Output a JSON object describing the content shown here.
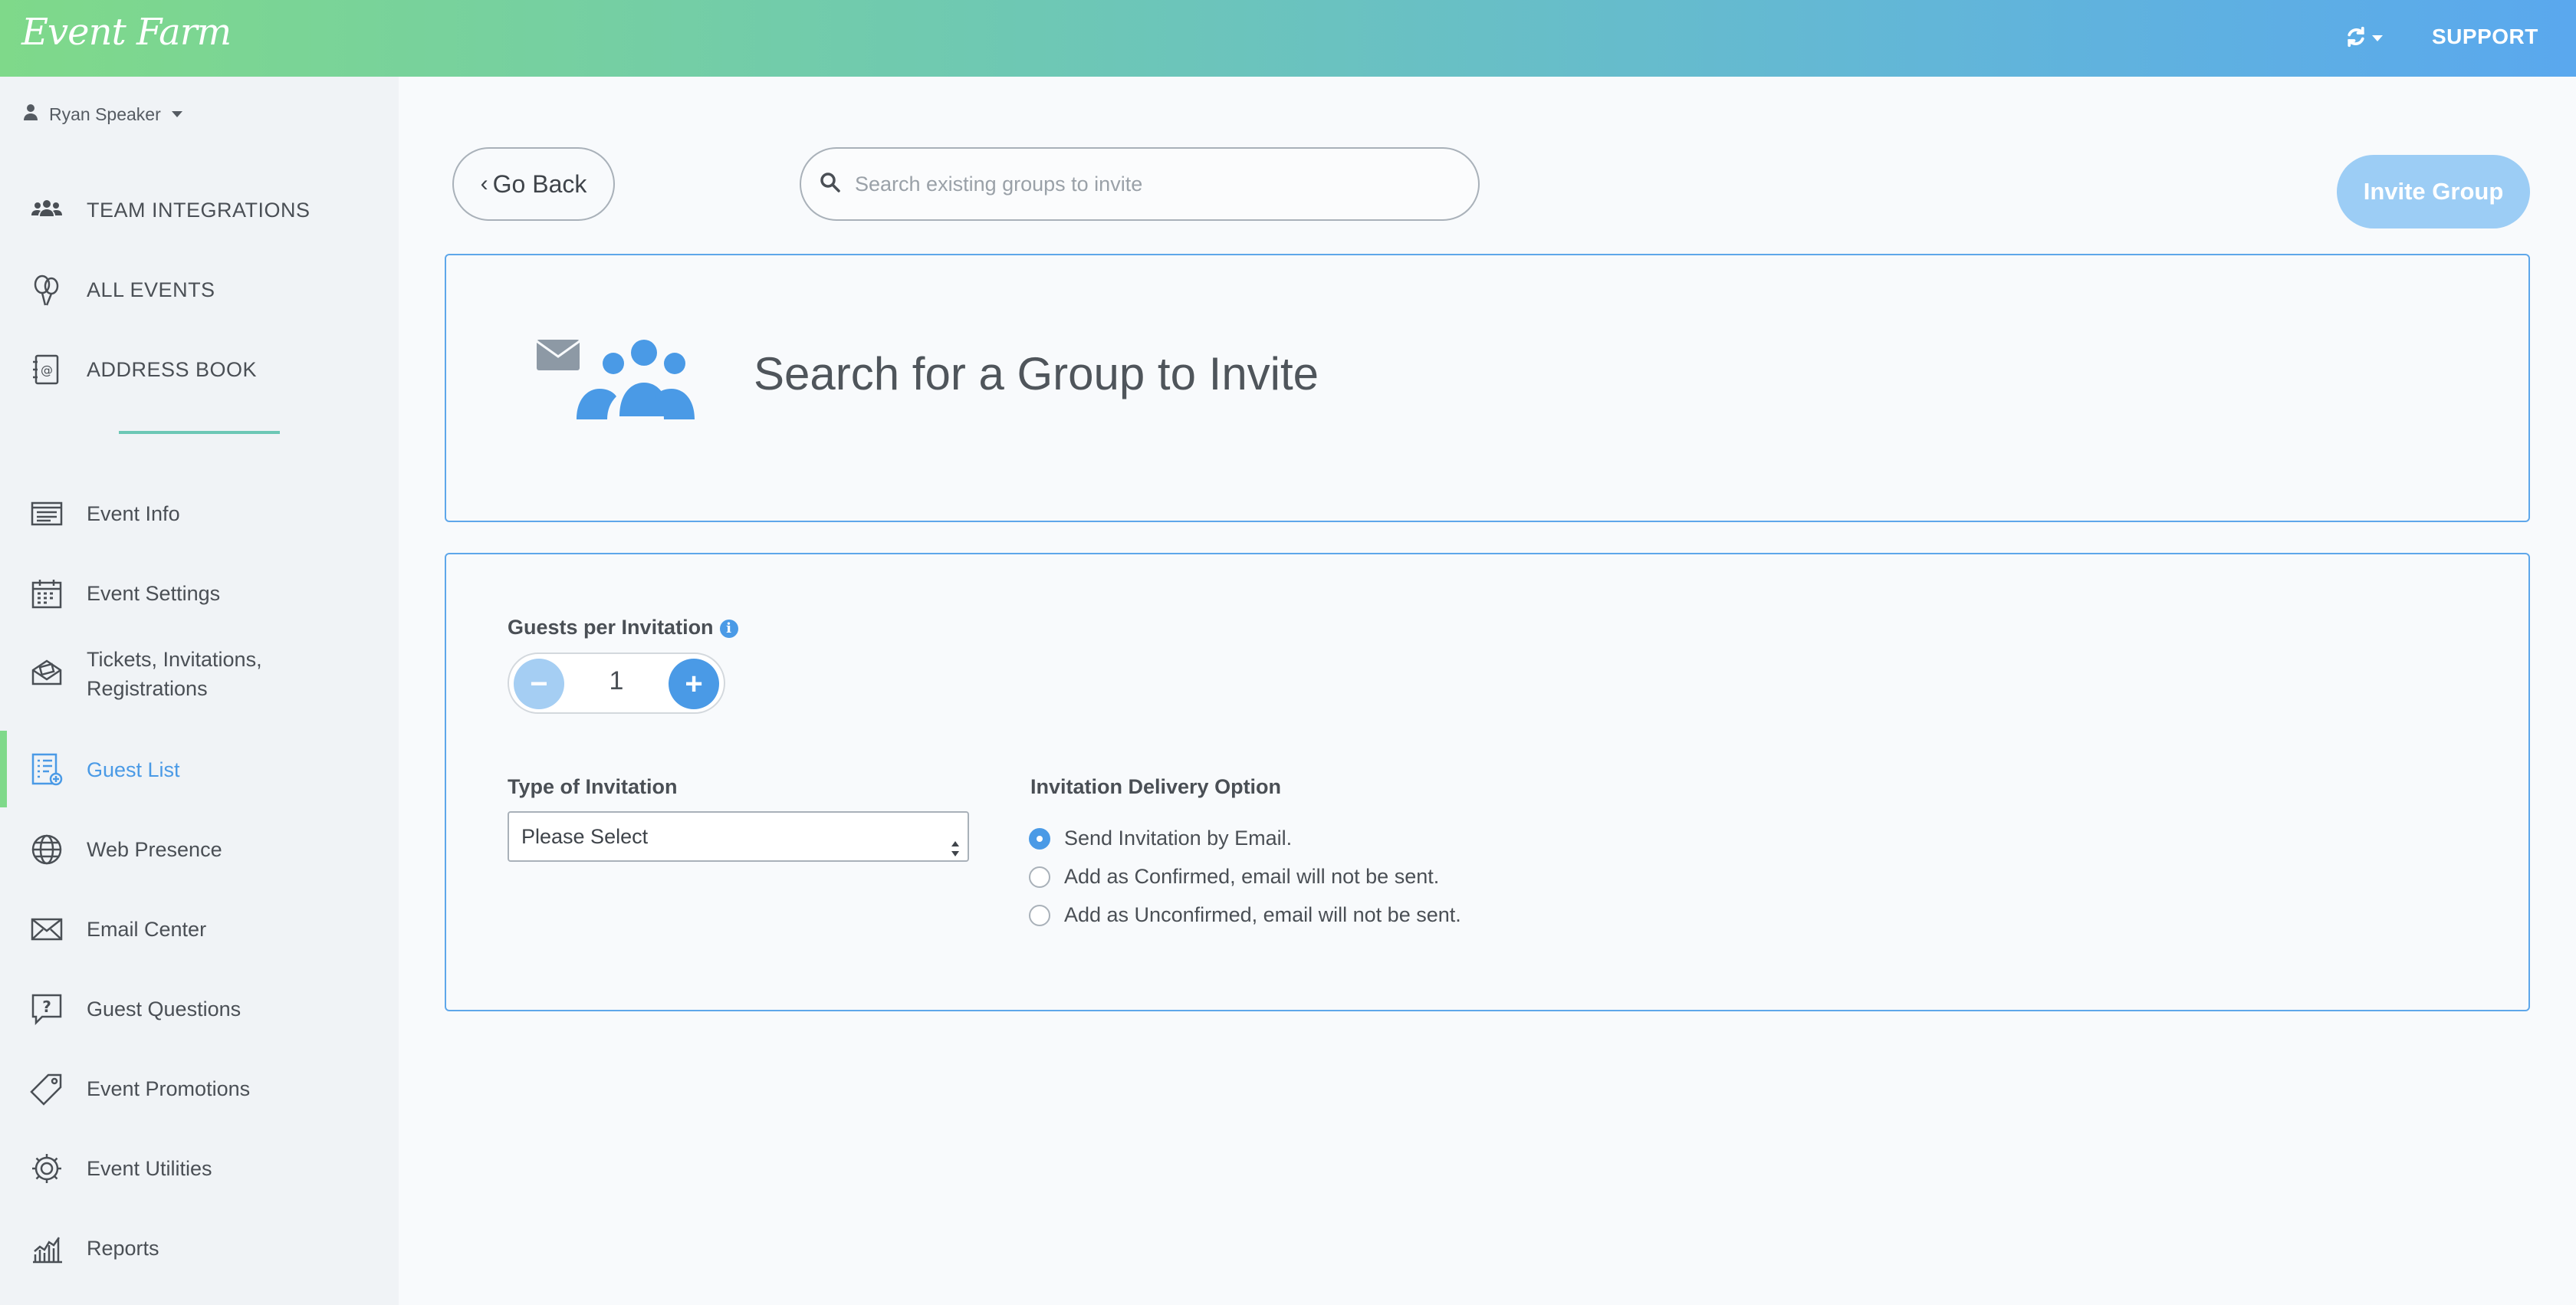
{
  "header": {
    "logo_text": "Event Farm",
    "support_label": "SUPPORT",
    "brand_gradient": [
      "#7fd98a",
      "#5aa8ee"
    ]
  },
  "sidebar": {
    "user_name": "Ryan Speaker",
    "top_items": [
      {
        "label": "TEAM INTEGRATIONS",
        "icon": "team-icon"
      },
      {
        "label": "ALL EVENTS",
        "icon": "balloons-icon"
      },
      {
        "label": "ADDRESS BOOK",
        "icon": "address-book-icon"
      }
    ],
    "event_items": [
      {
        "label": "Event Info",
        "icon": "event-info-icon"
      },
      {
        "label": "Event Settings",
        "icon": "calendar-icon"
      },
      {
        "label": "Tickets, Invitations, Registrations",
        "label_line1": "Tickets, Invitations,",
        "label_line2": "Registrations",
        "icon": "ticket-envelope-icon"
      },
      {
        "label": "Guest List",
        "icon": "guest-list-icon",
        "active": true
      },
      {
        "label": "Web Presence",
        "icon": "globe-icon"
      },
      {
        "label": "Email Center",
        "icon": "envelope-icon"
      },
      {
        "label": "Guest Questions",
        "icon": "question-icon"
      },
      {
        "label": "Event Promotions",
        "icon": "tag-icon"
      },
      {
        "label": "Event Utilities",
        "icon": "gear-icon"
      },
      {
        "label": "Reports",
        "icon": "bar-chart-icon"
      }
    ],
    "active_color": "#4a9ae6"
  },
  "toolbar": {
    "go_back_label": "Go Back",
    "search_placeholder": "Search existing groups to invite",
    "invite_group_label": "Invite Group"
  },
  "search_panel": {
    "title": "Search for a Group to Invite"
  },
  "form": {
    "guests_label": "Guests per Invitation",
    "guests_value": "1",
    "type_label": "Type of Invitation",
    "type_selected": "Please Select",
    "delivery_label": "Invitation Delivery Option",
    "delivery_options": [
      {
        "label": "Send Invitation by Email.",
        "checked": true
      },
      {
        "label": "Add as Confirmed, email will not be sent.",
        "checked": false
      },
      {
        "label": "Add as Unconfirmed, email will not be sent.",
        "checked": false
      }
    ]
  },
  "colors": {
    "accent": "#4a9ae6",
    "panel_border": "#5ea7ea",
    "invite_button_disabled": "#9ccdf5"
  }
}
